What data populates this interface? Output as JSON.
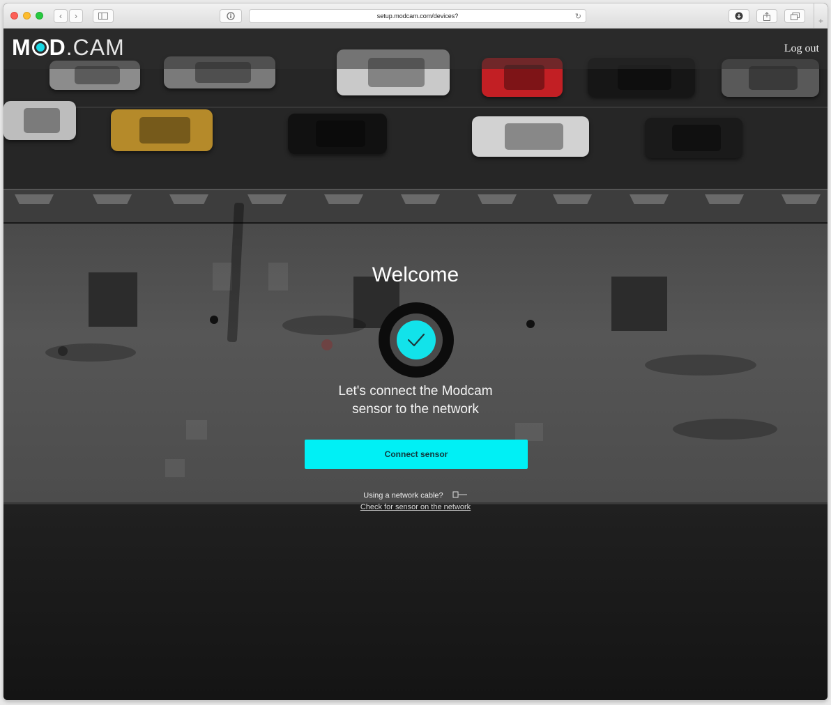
{
  "browser": {
    "url": "setup.modcam.com/devices?"
  },
  "header": {
    "logo_bold": "MOD",
    "logo_thin": ".CAM",
    "logout_label": "Log out"
  },
  "main": {
    "title": "Welcome",
    "subtitle_line1": "Let's connect the Modcam",
    "subtitle_line2": "sensor to the network",
    "connect_button_label": "Connect sensor",
    "cable_question": "Using a network cable?",
    "check_link": "Check for sensor on the network"
  },
  "colors": {
    "accent": "#00f0f5",
    "status_fill": "#12e3ea"
  },
  "icons": [
    "back-arrow-icon",
    "forward-arrow-icon",
    "sidebar-icon",
    "info-icon",
    "reload-icon",
    "download-icon",
    "share-icon",
    "tabs-icon",
    "plus-icon",
    "checkmark-icon",
    "network-cable-icon"
  ]
}
